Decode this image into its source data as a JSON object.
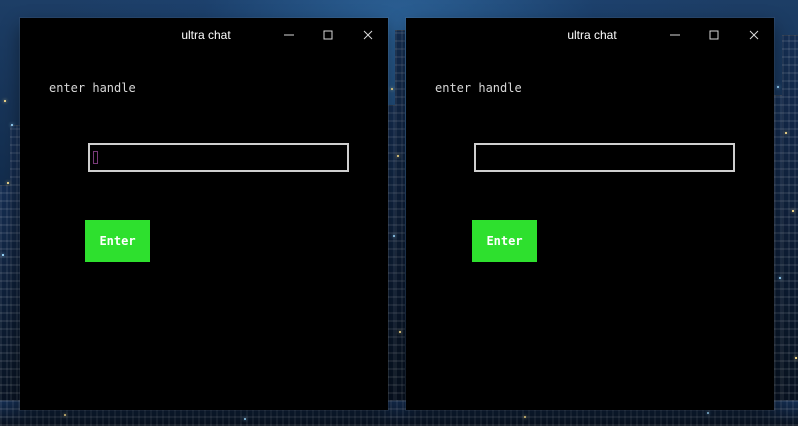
{
  "desktop": {
    "background_colors": {
      "sky_top": "#1d3e66",
      "sky_mid": "#0f2744",
      "sky_bottom": "#08121f",
      "window_lights": "#ffe390",
      "blue_lights": "#99d7ff"
    }
  },
  "windows": [
    {
      "title": "ultra chat",
      "controls": {
        "minimize_icon": "minimize-icon",
        "maximize_icon": "maximize-icon",
        "close_icon": "close-icon"
      },
      "handle_prompt": "enter handle",
      "handle_input": {
        "value": "",
        "placeholder": ""
      },
      "enter_label": "Enter",
      "colors": {
        "window_background": "#000000",
        "input_border": "#cfcfcf",
        "caret": "#7a3a7a",
        "enter_button": "#2ee02e"
      }
    },
    {
      "title": "ultra chat",
      "controls": {
        "minimize_icon": "minimize-icon",
        "maximize_icon": "maximize-icon",
        "close_icon": "close-icon"
      },
      "handle_prompt": "enter handle",
      "handle_input": {
        "value": "",
        "placeholder": ""
      },
      "enter_label": "Enter",
      "colors": {
        "window_background": "#000000",
        "input_border": "#cfcfcf",
        "enter_button": "#2ee02e"
      }
    }
  ]
}
